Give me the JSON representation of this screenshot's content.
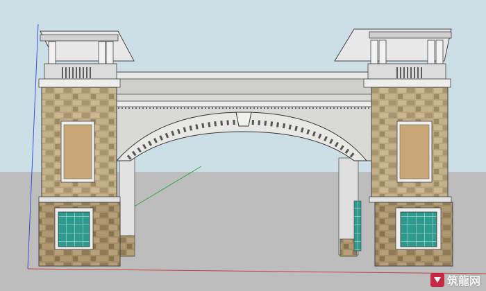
{
  "scene": {
    "sky_color": "#ccdfe7",
    "ground_color": "#bdbdbd",
    "axis_colors": {
      "red": "#d23b3b",
      "green": "#2fa84a",
      "blue": "#3c4fd6"
    }
  },
  "watermark": {
    "brand_text": "筑龍网",
    "logo_icon": "zhulong-logo-icon",
    "logo_color": "#c8102e"
  }
}
